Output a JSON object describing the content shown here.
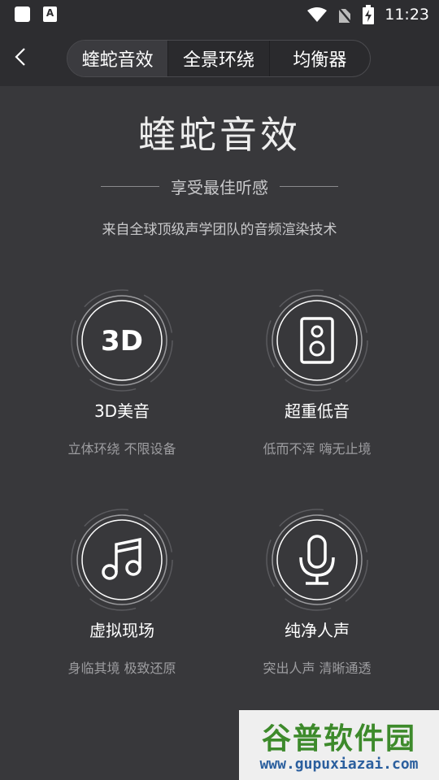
{
  "status_bar": {
    "time": "11:23",
    "notification_glyph": "A"
  },
  "header": {
    "back_icon": "chevron-left-icon",
    "tabs": [
      {
        "label": "蝰蛇音效",
        "active": true
      },
      {
        "label": "全景环绕",
        "active": false
      },
      {
        "label": "均衡器",
        "active": false
      }
    ]
  },
  "hero": {
    "title": "蝰蛇音效",
    "subtitle": "享受最佳听感",
    "description": "来自全球顶级声学团队的音频渲染技术"
  },
  "features": [
    {
      "icon_text": "3D",
      "icon": "3d-icon",
      "title": "3D美音",
      "subtitle": "立体环绕 不限设备"
    },
    {
      "icon": "speaker-icon",
      "title": "超重低音",
      "subtitle": "低而不浑 嗨无止境"
    },
    {
      "icon": "music-note-icon",
      "title": "虚拟现场",
      "subtitle": "身临其境 极致还原"
    },
    {
      "icon": "microphone-icon",
      "title": "纯净人声",
      "subtitle": "突出人声 清晰通透"
    }
  ],
  "watermark": {
    "title": "谷普软件园",
    "url": "www.gupuxiazai.com"
  },
  "colors": {
    "background": "#38383b",
    "header": "#2d2d30",
    "accent_green": "#3d8a2b",
    "accent_blue": "#2b5f9e"
  }
}
